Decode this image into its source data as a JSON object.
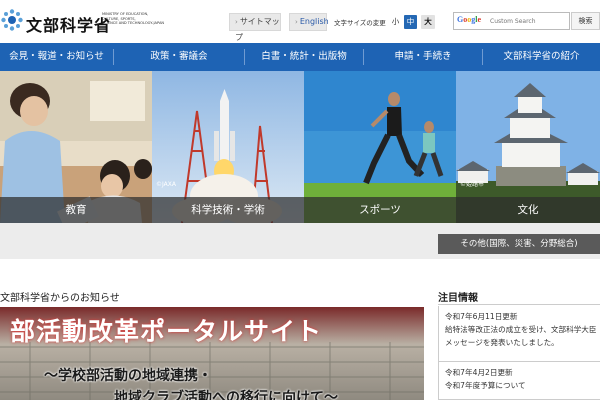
{
  "header": {
    "logo_ja": "文部科学省",
    "logo_en": "MINISTRY OF EDUCATION,\nCULTURE, SPORTS,\nSCIENCE AND TECHNOLOGY-JAPAN",
    "sitemap_label": "サイトマップ",
    "english_label": "English",
    "font_size_label": "文字サイズの変更",
    "font_size_small": "小",
    "font_size_medium": "中",
    "font_size_large": "大",
    "search_brand": "Google",
    "search_placeholder": "Custom Search",
    "search_button": "検索"
  },
  "gnav": {
    "items": [
      {
        "label": "会見・報道・お知らせ"
      },
      {
        "label": "政策・審議会"
      },
      {
        "label": "白書・統計・出版物"
      },
      {
        "label": "申請・手続き"
      },
      {
        "label": "文部科学省の紹介"
      }
    ]
  },
  "panels": [
    {
      "label": "教育",
      "credit": ""
    },
    {
      "label": "科学技術・学術",
      "credit": "©JAXA"
    },
    {
      "label": "スポーツ",
      "credit": ""
    },
    {
      "label": "文化",
      "credit": "©姫路市"
    }
  ],
  "other_label": "その他(国際、災害、分野総合)",
  "news": {
    "heading": "文部科学省からのお知らせ",
    "banner_title": "部活動改革ポータルサイト",
    "banner_sub1": "〜学校部活動の地域連携・",
    "banner_sub2": "地域クラブ活動への移行に向けて〜"
  },
  "notices": {
    "heading": "注目情報",
    "items": [
      {
        "date": "令和7年6月11日更新",
        "text": "給特法等改正法の成立を受け、文部科学大臣メッセージを発表いたしました。"
      },
      {
        "date": "令和7年4月2日更新",
        "text": "令和7年度予算について"
      }
    ]
  },
  "colors": {
    "nav_blue": "#1e63b4",
    "caption_bg": "#2d2d2d",
    "other_btn": "#5a5a5a"
  }
}
